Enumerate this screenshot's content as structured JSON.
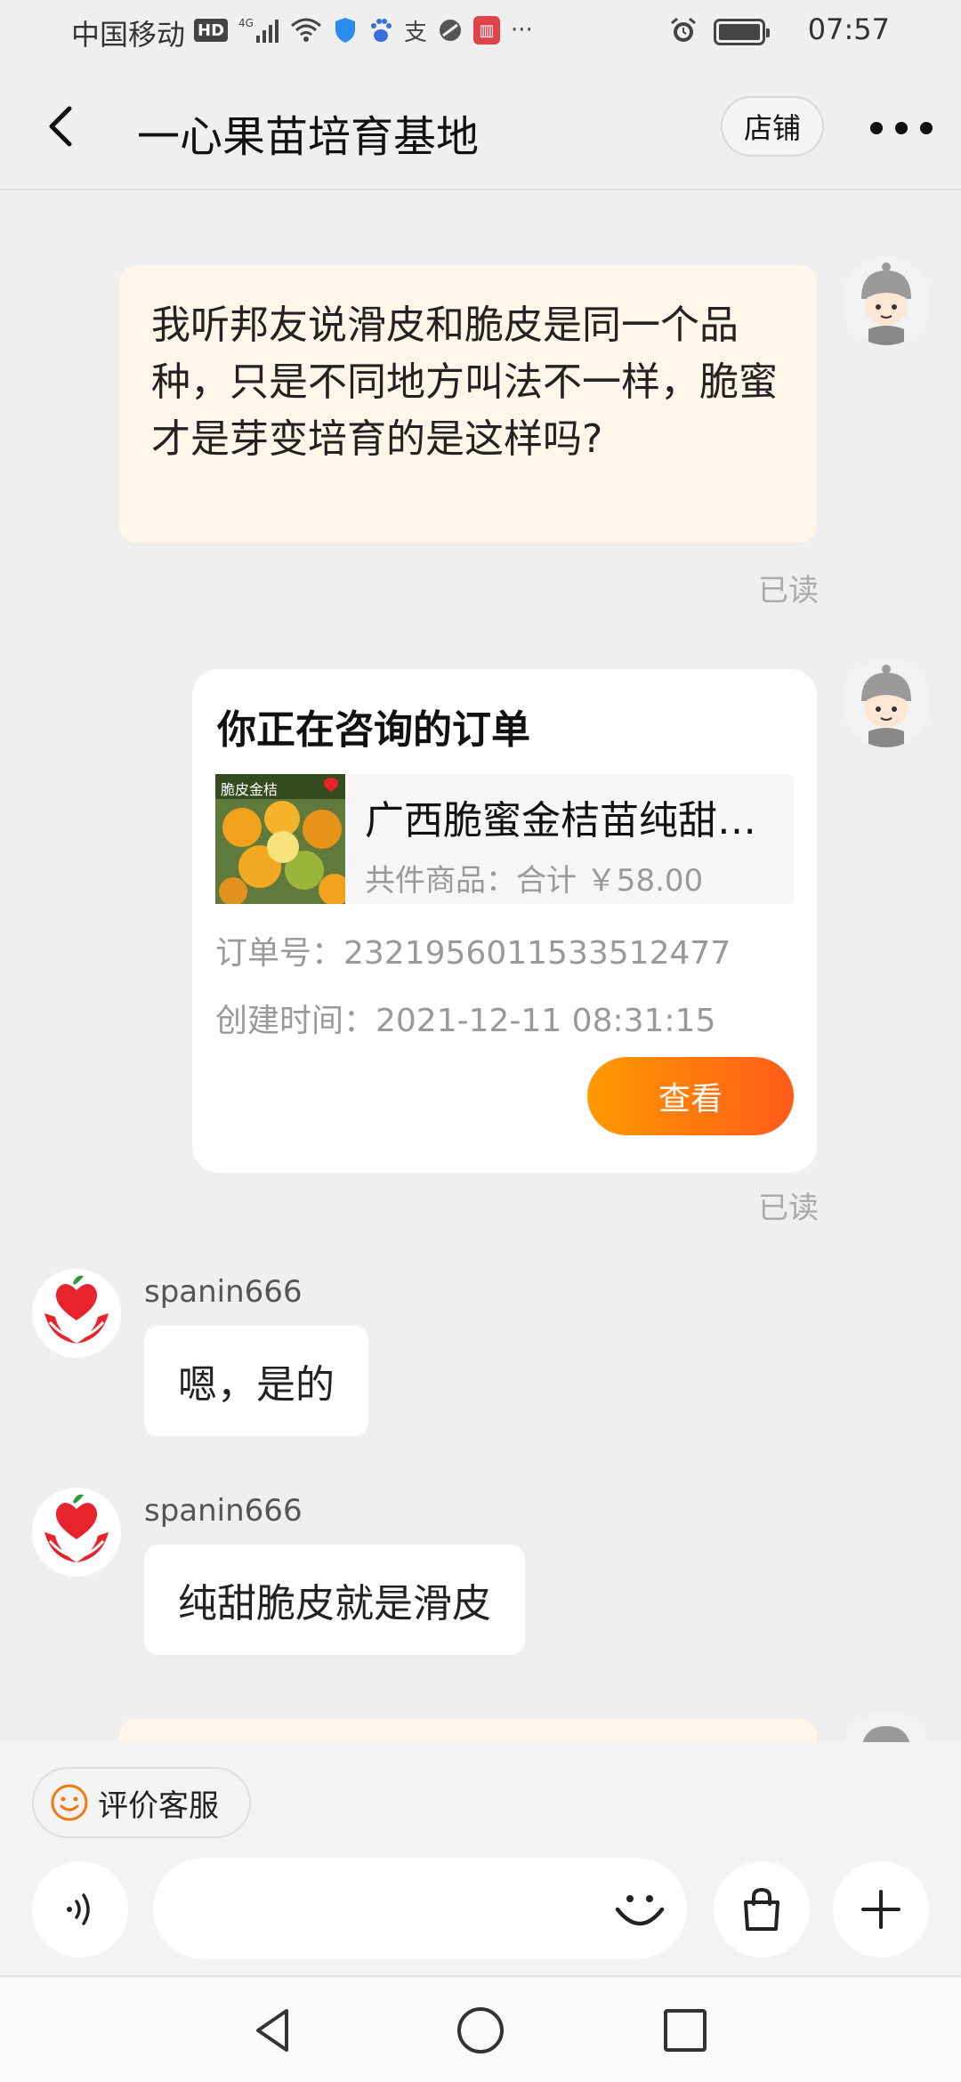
{
  "status_bar": {
    "carrier": "中国移动",
    "network": "4G",
    "hd": "HD",
    "time": "07:57"
  },
  "header": {
    "title": "一心果苗培育基地",
    "shop_label": "店铺"
  },
  "messages": {
    "msg1": {
      "text": "我听邦友说滑皮和脆皮是同一个品种，只是不同地方叫法不一样，脆蜜才是芽变培育的是这样吗?",
      "status": "已读"
    },
    "order_card": {
      "title": "你正在咨询的订单",
      "product_name": "广西脆蜜金桔苗纯甜脆皮金桔苗",
      "product_meta": "共件商品：合计 ￥58.00",
      "order_no": "订单号：2321956011533512477",
      "created": "创建时间：2021-12-11 08:31:15",
      "view_label": "查看",
      "status": "已读",
      "thumb_caption": "脆皮金桔"
    },
    "reply1": {
      "sender": "spanin666",
      "text": "嗯，是的"
    },
    "reply2": {
      "sender": "spanin666",
      "text": "纯甜脆皮就是滑皮"
    }
  },
  "footer": {
    "rate_label": "评价客服",
    "input_placeholder": ""
  },
  "colors": {
    "accent_start": "#ff9a00",
    "accent_end": "#ff5b1a",
    "sent_bubble": "#fff5e8",
    "shop_avatar_red": "#e8232c"
  }
}
